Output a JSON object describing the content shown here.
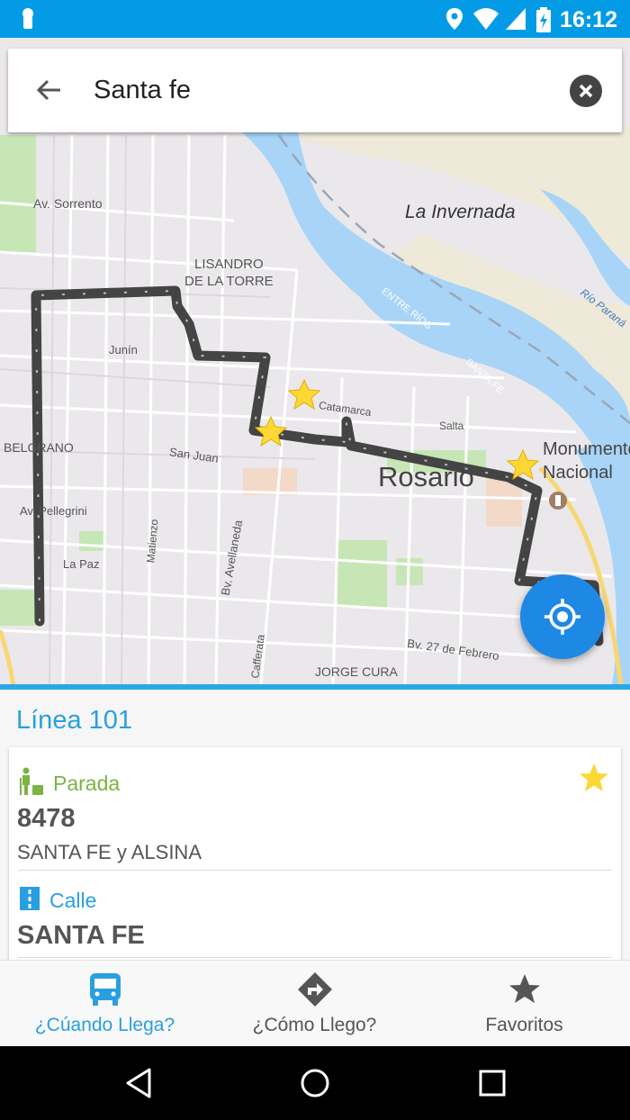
{
  "status_bar": {
    "time": "16:12"
  },
  "search": {
    "query": "Santa fe"
  },
  "map": {
    "labels": {
      "la_invernada": "La Invernada",
      "av_sorrento": "Av. Sorrento",
      "lisandro": "LISANDRO\nDE LA TORRE",
      "junin": "Junín",
      "belgrano": "BELGRANO",
      "san_juan": "San Juan",
      "av_pellegrini": "Av. Pellegrini",
      "la_paz": "La Paz",
      "matienzo": "Matienzo",
      "bv_avellaneda": "Bv. Avellaneda",
      "catamarca": "Catamarca",
      "salta": "Salta",
      "rosario": "Rosario",
      "monumento": "Monumento\nNacional",
      "entre_rios": "ENTRE RÍOS",
      "santa_fe_river": "SANTA FE",
      "rio_parana": "Río Paraná",
      "cafferata": "Cafferata",
      "bv_27": "Bv. 27 de Febrero",
      "jorge_cura": "JORGE CURA"
    },
    "colors": {
      "water": "#a8d4f7",
      "route": "#444444",
      "star": "#fdd835",
      "park": "#c6e7b5"
    }
  },
  "line": {
    "title": "Línea 101"
  },
  "stop": {
    "label": "Parada",
    "number": "8478",
    "address": "SANTA FE y ALSINA",
    "street_label": "Calle",
    "street": "SANTA FE",
    "favorite": true
  },
  "nav": {
    "items": [
      {
        "label": "¿Cúando Llega?",
        "icon": "bus-icon",
        "active": true
      },
      {
        "label": "¿Cómo Llego?",
        "icon": "directions-icon",
        "active": false
      },
      {
        "label": "Favoritos",
        "icon": "star-icon",
        "active": false
      }
    ]
  },
  "accent": "#2a9fe0"
}
